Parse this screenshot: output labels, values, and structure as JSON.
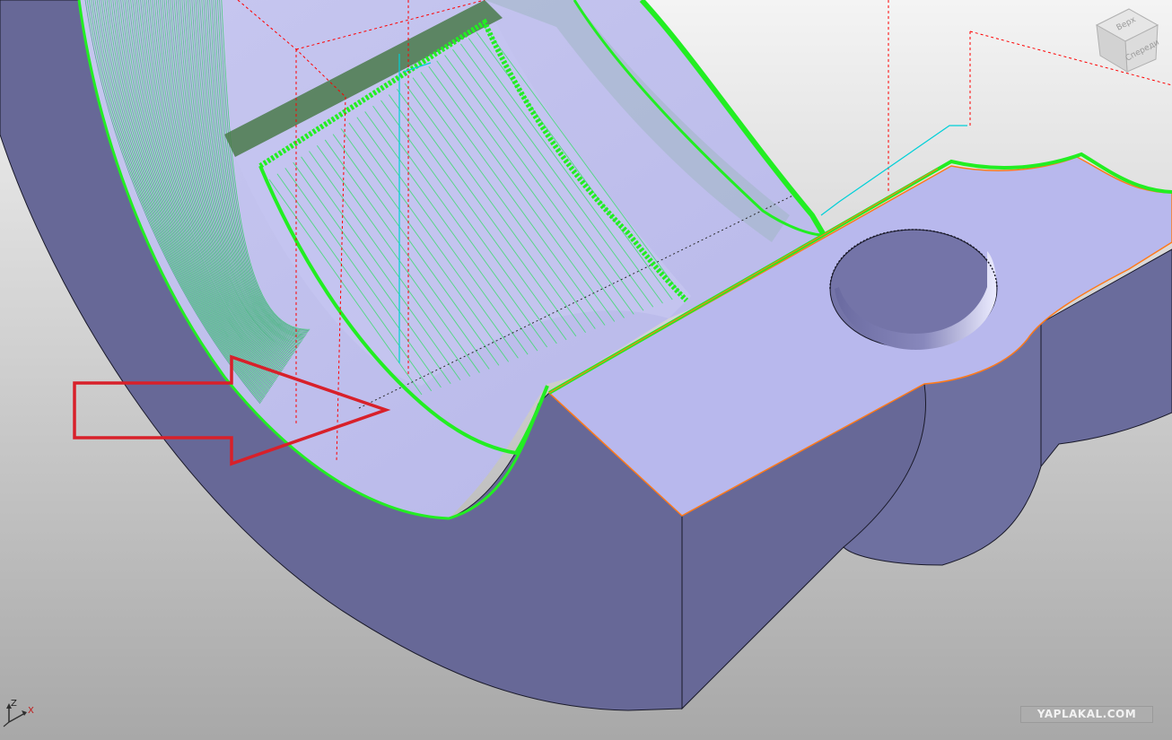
{
  "viewcube": {
    "top_label": "Верх",
    "front_label": "Спереди"
  },
  "axes": {
    "x_label": "X",
    "z_label": "Z"
  },
  "watermark": "YAPLAKAL.COM",
  "colors": {
    "background_top": "#f4f4f4",
    "background_bottom": "#a8a8a8",
    "part_side": "#676897",
    "part_top": "#b8b8ed",
    "toolpath": "#22ee22",
    "toolpath_rapid": "#ff0000",
    "toolpath_link": "#00d0d8",
    "annotation_arrow": "#d8202a",
    "edge_highlight": "#ff7a1a"
  }
}
